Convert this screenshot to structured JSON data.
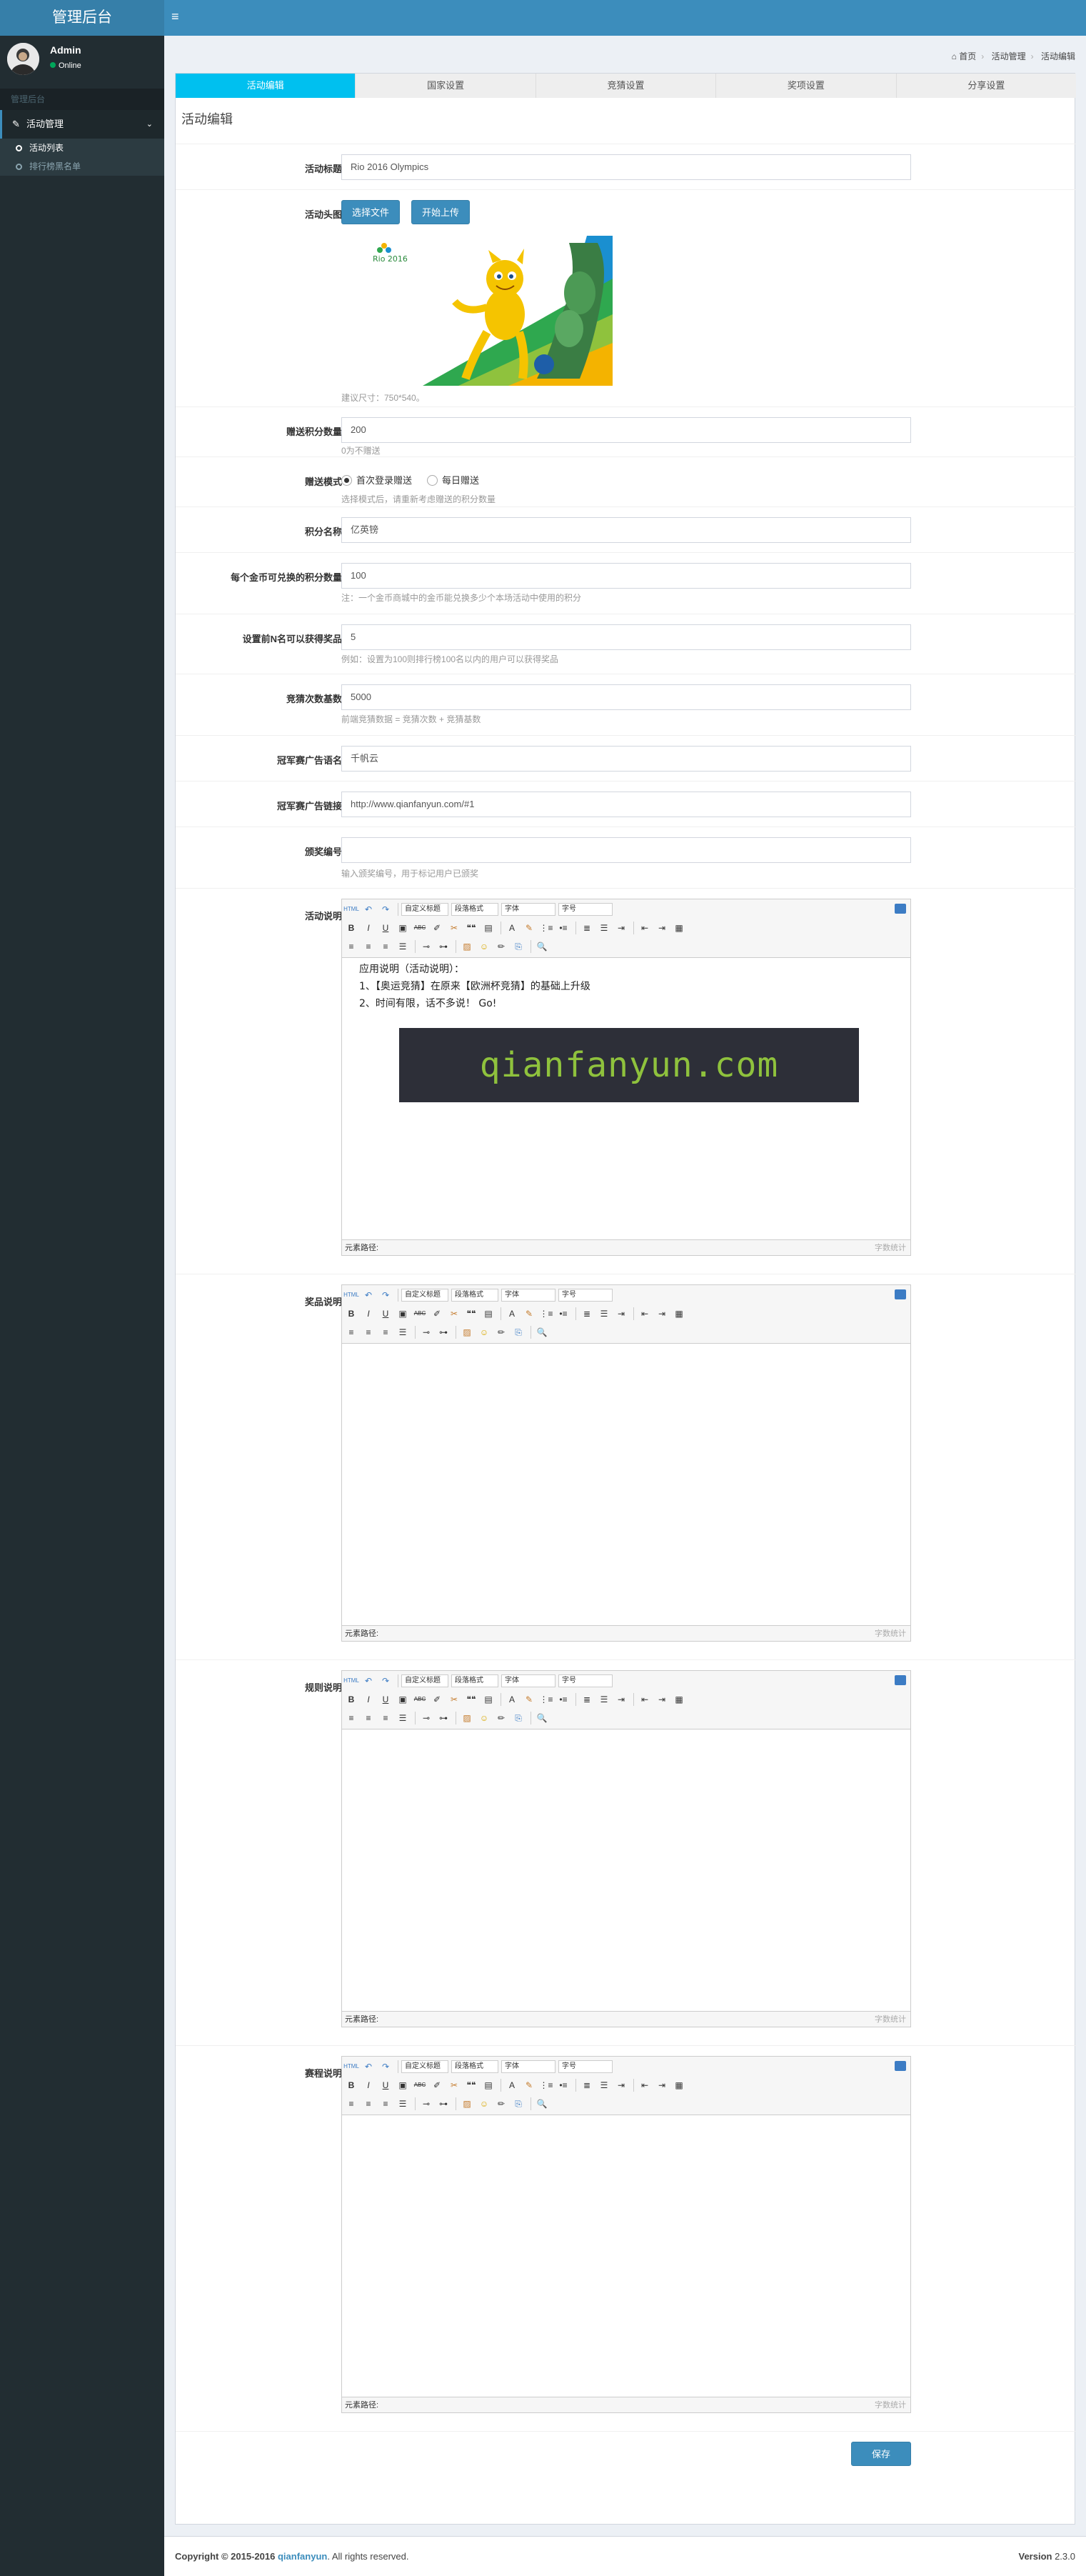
{
  "app": {
    "logo": "管理后台",
    "menu_toggle": "≡"
  },
  "user": {
    "name": "Admin",
    "status": "Online"
  },
  "sidebar": {
    "header": "管理后台",
    "menu": {
      "label": "活动管理",
      "items": [
        {
          "label": "活动列表"
        },
        {
          "label": "排行榜黑名单"
        }
      ]
    }
  },
  "breadcrumb": [
    "首页",
    "活动管理",
    "活动编辑"
  ],
  "tabs": [
    {
      "label": "活动编辑",
      "active": true
    },
    {
      "label": "国家设置"
    },
    {
      "label": "竞猜设置"
    },
    {
      "label": "奖项设置"
    },
    {
      "label": "分享设置"
    }
  ],
  "section_title": "活动编辑",
  "form": {
    "title": {
      "label": "活动标题",
      "value": "Rio 2016 Olympics"
    },
    "header_image": {
      "label": "活动头图",
      "choose_button": "选择文件",
      "upload_button": "开始上传",
      "image_caption": "Rio 2016",
      "help": "建议尺寸：750*540。"
    },
    "gift_points": {
      "label": "赠送积分数量",
      "value": "200",
      "help": "0为不赠送"
    },
    "gift_mode": {
      "label": "赠送模式",
      "options": [
        {
          "label": "首次登录赠送",
          "checked": true
        },
        {
          "label": "每日赠送",
          "checked": false
        }
      ],
      "help": "选择模式后，请重新考虑赠送的积分数量"
    },
    "points_name": {
      "label": "积分名称",
      "value": "亿英镑"
    },
    "points_per_coin": {
      "label": "每个金币可兑换的积分数量",
      "value": "100",
      "help": "注：一个金币商城中的金币能兑换多少个本场活动中使用的积分"
    },
    "top_n": {
      "label": "设置前N名可以获得奖品",
      "value": "5",
      "help": "例如：设置为100则排行榜100名以内的用户可以获得奖品"
    },
    "guess_base": {
      "label": "竞猜次数基数",
      "value": "5000",
      "help": "前端竞猜数据 = 竞猜次数 + 竞猜基数"
    },
    "champion_ad_name": {
      "label": "冠军赛广告语名",
      "value": "千帆云"
    },
    "champion_ad_link": {
      "label": "冠军赛广告链接",
      "value": "http://www.qianfanyun.com/#1"
    },
    "prize_code": {
      "label": "颁奖编号",
      "placeholder": "",
      "help": "输入颁奖编号，用于标记用户已颁奖"
    },
    "activity_desc": {
      "label": "活动说明",
      "lines": [
        "应用说明（活动说明）：",
        "1、【奥运竞猜】在原来【欧洲杯竞猜】的基础上升级",
        "2、时间有限，话不多说！ Go!"
      ],
      "banner_text": "qianfanyun.com"
    },
    "prize_desc": {
      "label": "奖品说明"
    },
    "rules_desc": {
      "label": "规则说明"
    },
    "schedule_desc": {
      "label": "赛程说明"
    },
    "save_button": "保存"
  },
  "editor": {
    "custom_title": "自定义标题",
    "paragraph": "段落格式",
    "font": "字体",
    "size": "字号",
    "path_label": "元素路径:",
    "word_count": "字数统计",
    "source": "HTML",
    "buttons_row2": {
      "bold": "B",
      "italic": "I",
      "underline": "U",
      "strike": "ABC",
      "quote": "❝❝",
      "font_color": "A",
      "ordered": "⋮≡",
      "unordered": "•≡"
    },
    "buttons_row3": {
      "smiley": "☺",
      "search": "🔍"
    }
  },
  "footer": {
    "copyright": "Copyright © 2015-2016",
    "company": "qianfanyun",
    "rights": ". All rights reserved.",
    "version_label": "Version",
    "version": "2.3.0"
  },
  "colors": {
    "header": "#3c8dbc",
    "logo_bg": "#367fa9",
    "sidebar": "#222d32",
    "tab_active": "#00c0ef",
    "online": "#00a65a"
  }
}
